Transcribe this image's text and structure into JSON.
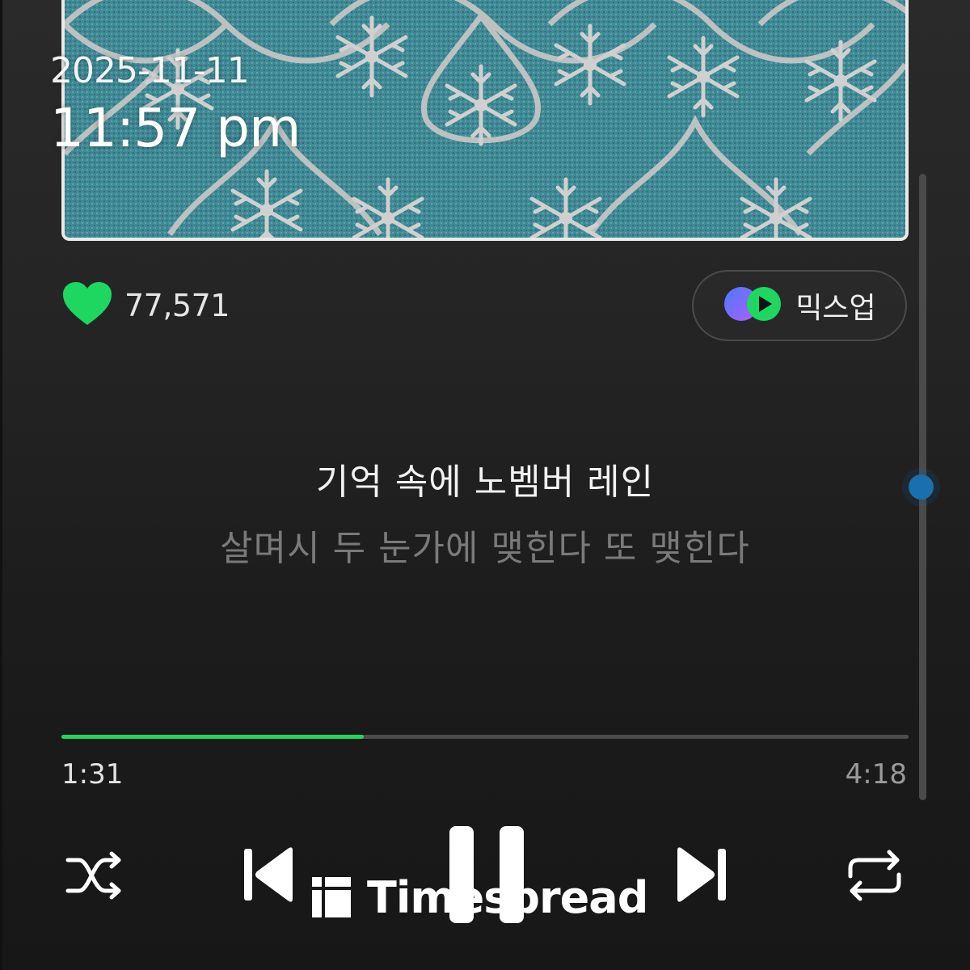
{
  "overlay": {
    "date": "2025-11-11",
    "time": "11:57 pm"
  },
  "album_art": {
    "icon": "snowflake-damask-pattern",
    "base_color": "#3d8a96",
    "ornament_color": "#c9c9c9"
  },
  "like": {
    "icon": "heart-icon",
    "count": "77,571",
    "color": "#1ed760"
  },
  "mixup": {
    "label": "믹스업",
    "icon": "mixup-icon"
  },
  "lyrics": {
    "current": "기억 속에 노벰버 레인",
    "next": "살며시 두 눈가에 맺힌다 또 맺힌다"
  },
  "playback": {
    "elapsed": "1:31",
    "total": "4:18",
    "progress_fraction": 0.357,
    "accent": "#1ed760"
  },
  "scrollbar": {
    "position_fraction": 0.48
  },
  "controls": {
    "shuffle_icon": "shuffle-icon",
    "prev_icon": "skip-previous-icon",
    "pause_icon": "pause-icon",
    "next_icon": "skip-next-icon",
    "repeat_icon": "repeat-icon"
  },
  "watermark": {
    "text": "Timespread"
  }
}
